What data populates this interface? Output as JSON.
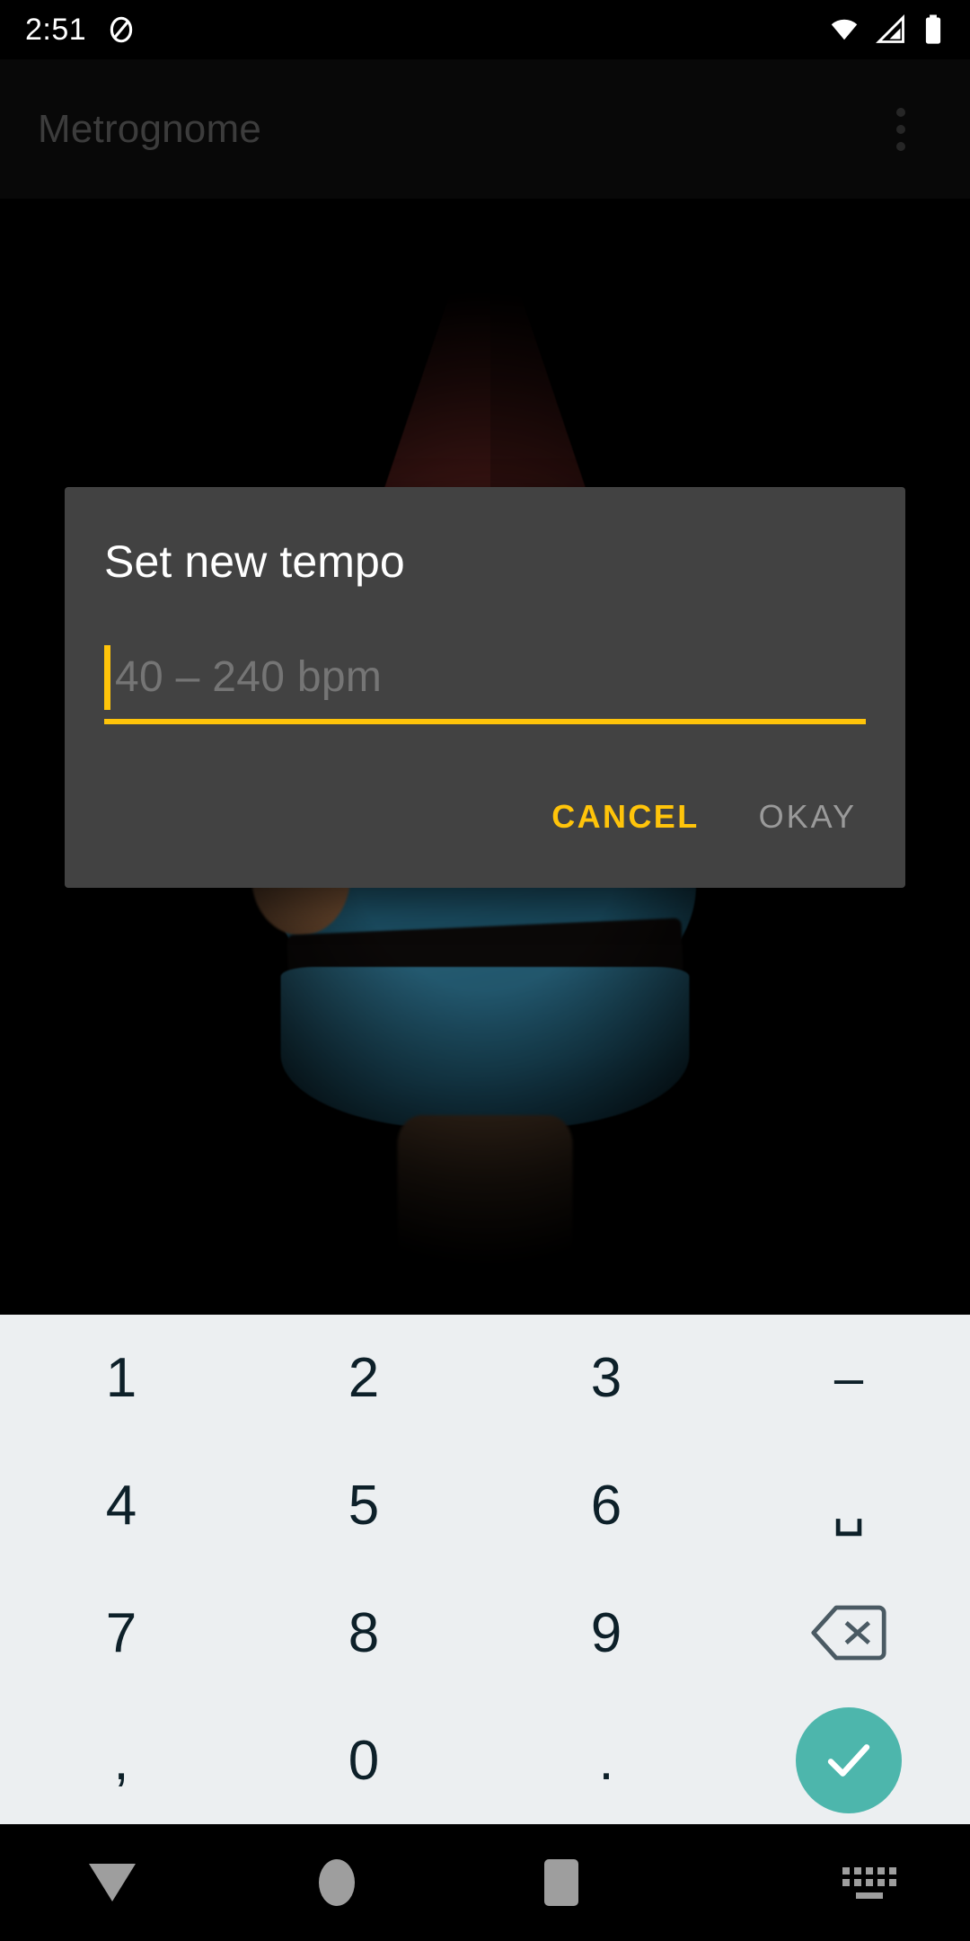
{
  "status_bar": {
    "clock": "2:51",
    "left_icons": [
      "dnd-icon"
    ],
    "right_icons": [
      "wifi-icon",
      "cell-signal-icon",
      "battery-icon"
    ]
  },
  "app_bar": {
    "title": "Metrognome",
    "overflow_icon": "overflow-menu-icon"
  },
  "content": {
    "artwork_name": "garden-gnome-photo",
    "colors": {
      "hat": "#742a26",
      "coat": "#2e7fa0",
      "belt": "#120e0d",
      "skin": "#c98f63",
      "beard": "#d8d2cc",
      "background": "#000000"
    }
  },
  "dialog": {
    "title": "Set new tempo",
    "input": {
      "value": "",
      "placeholder": "40 – 240 bpm",
      "cursor_color": "#ffc40a",
      "underline_color": "#ffc40a"
    },
    "buttons": {
      "cancel_label": "CANCEL",
      "cancel_color": "#ffc40a",
      "okay_label": "OKAY",
      "okay_color": "#9a9a9a",
      "okay_enabled": false
    },
    "background_color": "#424242"
  },
  "keyboard": {
    "background_color": "#eceff1",
    "key_color": "#0d2029",
    "enter_key_color": "#4db6ac",
    "keys": [
      {
        "label": "1",
        "name": "key-1"
      },
      {
        "label": "2",
        "name": "key-2"
      },
      {
        "label": "3",
        "name": "key-3"
      },
      {
        "label": "–",
        "name": "key-dash"
      },
      {
        "label": "4",
        "name": "key-4"
      },
      {
        "label": "5",
        "name": "key-5"
      },
      {
        "label": "6",
        "name": "key-6"
      },
      {
        "label": "␣",
        "name": "key-space"
      },
      {
        "label": "7",
        "name": "key-7"
      },
      {
        "label": "8",
        "name": "key-8"
      },
      {
        "label": "9",
        "name": "key-9"
      },
      {
        "label": "⌫",
        "name": "key-backspace"
      },
      {
        "label": ",",
        "name": "key-comma"
      },
      {
        "label": "0",
        "name": "key-0"
      },
      {
        "label": ".",
        "name": "key-period"
      },
      {
        "label": "✓",
        "name": "key-enter"
      }
    ]
  },
  "nav_bar": {
    "back_label": "back",
    "home_label": "home",
    "recents_label": "recents",
    "ime_switcher_label": "switch input method"
  }
}
